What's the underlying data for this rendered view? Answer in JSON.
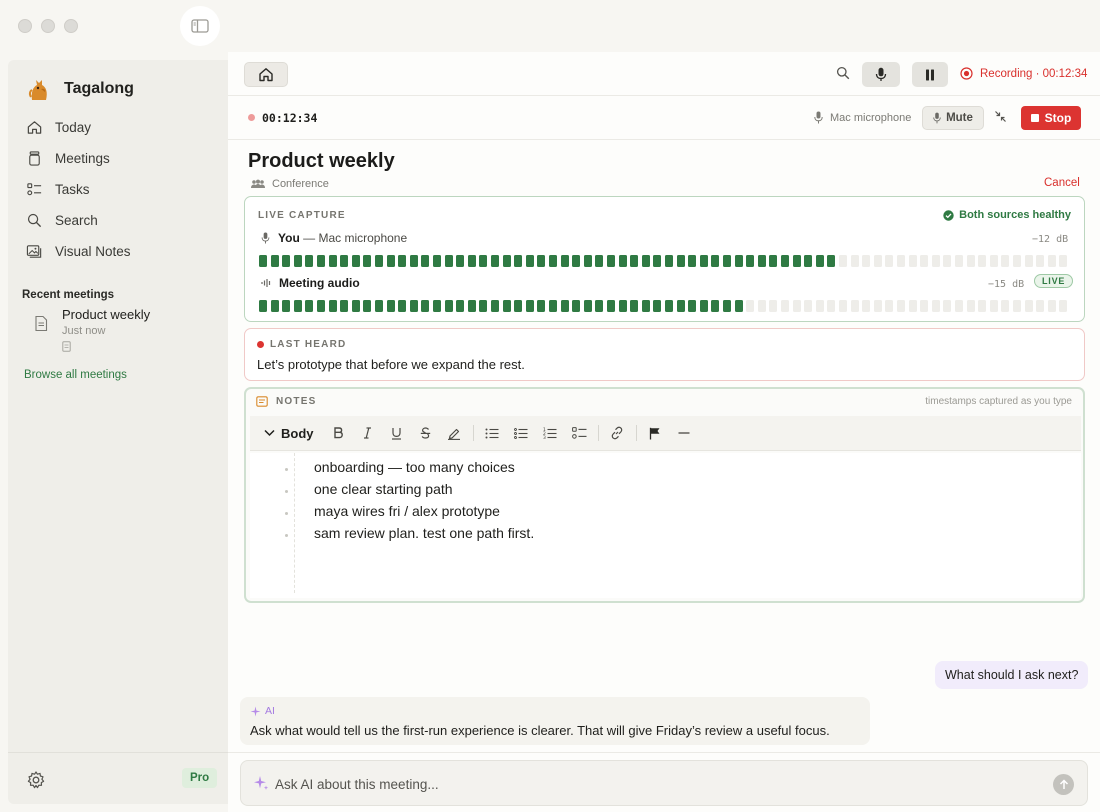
{
  "app": {
    "name": "Tagalong"
  },
  "sidebar": {
    "nav": [
      {
        "label": "Today",
        "icon": "home-icon"
      },
      {
        "label": "Meetings",
        "icon": "jar-icon"
      },
      {
        "label": "Tasks",
        "icon": "tasks-icon"
      },
      {
        "label": "Search",
        "icon": "search-icon"
      },
      {
        "label": "Visual Notes",
        "icon": "images-icon"
      }
    ],
    "recent_title": "Recent meetings",
    "recent": [
      {
        "title": "Product weekly",
        "subtitle": "Just now"
      }
    ],
    "browse_label": "Browse all meetings",
    "plan_badge": "Pro"
  },
  "topbar": {
    "recording_status": "Recording · 00:12:34"
  },
  "recording": {
    "elapsed": "00:12:34",
    "mic_source": "Mac microphone",
    "mute_label": "Mute",
    "stop_label": "Stop"
  },
  "meeting": {
    "title": "Product weekly",
    "type": "Conference",
    "cancel_label": "Cancel"
  },
  "capture": {
    "label": "LIVE CAPTURE",
    "health": "Both sources healthy",
    "sources": [
      {
        "name": "You",
        "detail": " — Mac microphone",
        "level_db": "−12 dB",
        "level": 0.72,
        "icon": "mic-icon"
      },
      {
        "name": "Meeting audio",
        "detail": "",
        "level_db": "−15 dB",
        "level": 0.6,
        "badge": "LIVE",
        "icon": "speaker-icon"
      }
    ]
  },
  "last_heard": {
    "label": "LAST HEARD",
    "text": "Let’s prototype that before we expand the rest."
  },
  "notes": {
    "label": "NOTES",
    "hint": "timestamps captured as you type",
    "style_label": "Body",
    "lines": [
      "onboarding — too many choices",
      "one clear starting path",
      "maya wires fri / alex prototype",
      "sam review plan. test one path first."
    ]
  },
  "chat": {
    "user_message": "What should I ask next?",
    "ai_label": "AI",
    "ai_message": "Ask what would tell us the first-run experience is clearer. That will give Friday’s review a useful focus.",
    "input_placeholder": "Ask AI about this meeting..."
  },
  "colors": {
    "accent_green": "#2f7a43",
    "record_red": "#dc3431",
    "meter_on": "#2f7a43",
    "meter_off": "#eeede9"
  }
}
